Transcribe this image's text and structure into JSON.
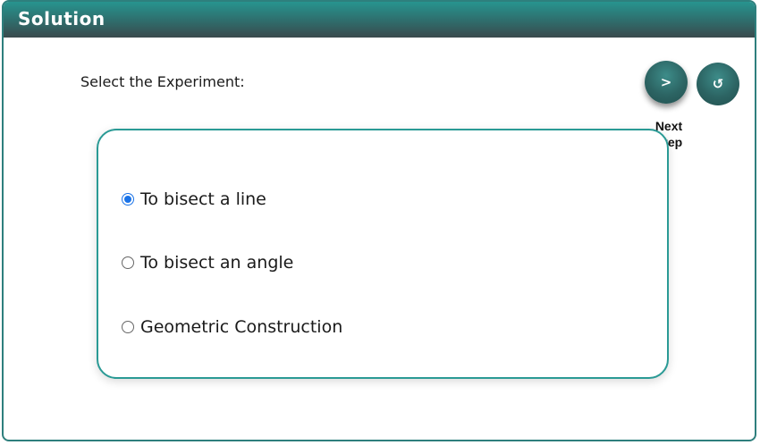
{
  "panel": {
    "title": "Solution"
  },
  "prompt": "Select the Experiment:",
  "buttons": {
    "next_glyph": ">",
    "reset_glyph": "↺",
    "next_label": "Next Step"
  },
  "options": [
    {
      "label": "To bisect a line",
      "checked": true
    },
    {
      "label": "To bisect an angle",
      "checked": false
    },
    {
      "label": "Geometric Construction",
      "checked": false
    }
  ],
  "colors": {
    "accent": "#2a9a95",
    "header_dark": "#3a4a4d",
    "radio_checked": "#1a73e8"
  }
}
